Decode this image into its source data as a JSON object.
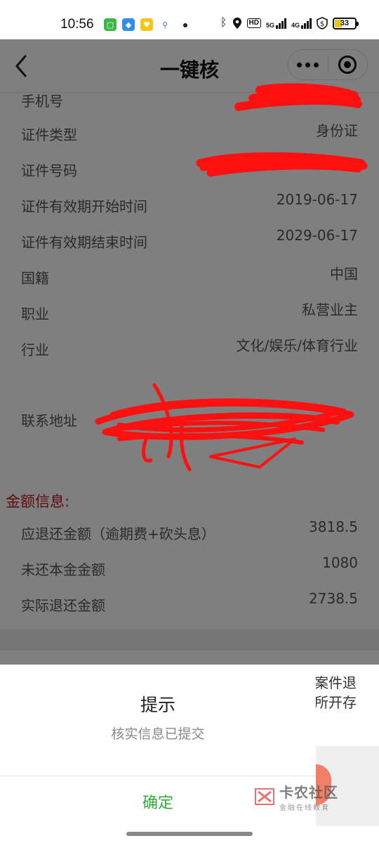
{
  "status_bar": {
    "time": "10:56",
    "network_5g": "5G",
    "network_4g": "4G",
    "hd_badge": "HD",
    "battery": "33"
  },
  "nav": {
    "title": "一键核"
  },
  "info_rows": [
    {
      "label": "手机号",
      "value": ""
    },
    {
      "label": "证件类型",
      "value": "身份证"
    },
    {
      "label": "证件号码",
      "value": ""
    },
    {
      "label": "证件有效期开始时间",
      "value": "2019-06-17"
    },
    {
      "label": "证件有效期结束时间",
      "value": "2029-06-17"
    },
    {
      "label": "国籍",
      "value": "中国"
    },
    {
      "label": "职业",
      "value": "私营业主"
    },
    {
      "label": "行业",
      "value": "文化/娱乐/体育行业"
    },
    {
      "label": "联系地址",
      "value": ""
    }
  ],
  "amount_section": {
    "title": "金额信息:",
    "rows": [
      {
        "label": "应退还金额（逾期费+砍头息）",
        "value": "3818.5"
      },
      {
        "label": "未还本金金额",
        "value": "1080"
      },
      {
        "label": "实际退还金额",
        "value": "2738.5"
      }
    ]
  },
  "behind_text": {
    "line1": "案件退",
    "line2": "所开存"
  },
  "dialog": {
    "title": "提示",
    "message": "核实信息已提交",
    "confirm_label": "确定"
  },
  "watermark": {
    "main": "卡农社区",
    "sub": "金融在线教育"
  }
}
